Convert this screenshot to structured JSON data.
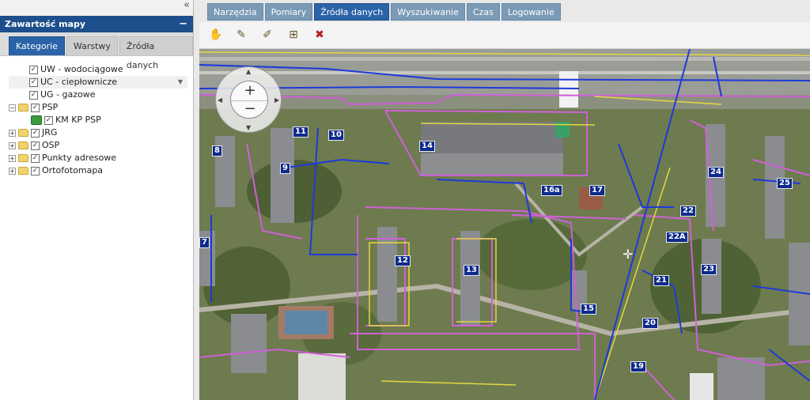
{
  "left_panel": {
    "collapse_icon": "«",
    "title": "Zawartość mapy",
    "minimize_icon": "−",
    "tabs": [
      {
        "label": "Kategorie",
        "active": true
      },
      {
        "label": "Warstwy",
        "active": false
      },
      {
        "label": "Źródła danych",
        "active": false
      }
    ],
    "tree": [
      {
        "label": "UW - wodociągowe",
        "checked": true
      },
      {
        "label": "UC - ciepłownicze",
        "checked": true,
        "selected": true
      },
      {
        "label": "UG - gazowe",
        "checked": true
      },
      {
        "label": "PSP",
        "checked": true,
        "expanded": true
      },
      {
        "label": "KM KP PSP",
        "checked": true
      },
      {
        "label": "JRG",
        "checked": true
      },
      {
        "label": "OSP",
        "checked": true
      },
      {
        "label": "Punkty adresowe",
        "checked": true
      },
      {
        "label": "Ortofotomapa",
        "checked": true
      }
    ]
  },
  "top_tabs": [
    {
      "label": "Narzędzia",
      "active": false
    },
    {
      "label": "Pomiary",
      "active": false
    },
    {
      "label": "Źródła danych",
      "active": true
    },
    {
      "label": "Wyszukiwanie",
      "active": false
    },
    {
      "label": "Czas",
      "active": false
    },
    {
      "label": "Logowanie",
      "active": false
    }
  ],
  "toolbar": [
    "layer-tool-1-icon",
    "layer-tool-2-icon",
    "layer-edit-icon",
    "layer-add-icon",
    "layer-delete-icon"
  ],
  "map": {
    "zoom_in": "+",
    "zoom_out": "−",
    "building_labels": [
      "8",
      "11",
      "10",
      "9",
      "14",
      "16a",
      "17",
      "24",
      "25",
      "22",
      "22A",
      "12",
      "13",
      "21",
      "23",
      "15",
      "20",
      "19",
      "7"
    ]
  }
}
